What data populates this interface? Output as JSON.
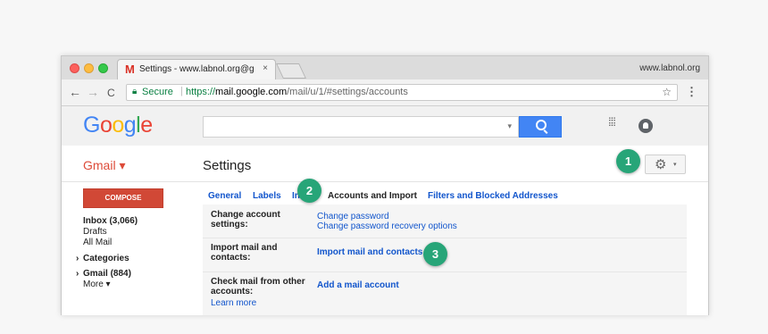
{
  "browser": {
    "tab_title": "Settings - www.labnol.org@gm",
    "tab_favicon": "M",
    "tab_close": "×",
    "window_label": "www.labnol.org",
    "back": "←",
    "forward": "→",
    "reload": "C",
    "secure_label": "Secure",
    "url_protocol": "https://",
    "url_host": "mail.google.com",
    "url_path": "/mail/u/1/#settings/accounts",
    "bookmark_icon": "☆",
    "menu_icon": "⋮"
  },
  "header": {
    "logo": [
      "G",
      "o",
      "o",
      "g",
      "l",
      "e"
    ],
    "search_caret": "▾",
    "apps_icon": "⁞⁞⁞"
  },
  "subbar": {
    "gmail_label": "Gmail ▾",
    "settings_title": "Settings",
    "gear_icon": "⚙",
    "gear_dropdown": "▾"
  },
  "callouts": [
    "1",
    "2",
    "3"
  ],
  "sidebar": {
    "compose_label": "COMPOSE",
    "items": [
      {
        "label": "Inbox (3,066)",
        "bold": true
      },
      {
        "label": "Drafts",
        "bold": false
      },
      {
        "label": "All Mail",
        "bold": false
      },
      {
        "label": "Categories",
        "bold": true,
        "arrow": "›"
      },
      {
        "label": "Gmail (884)",
        "bold": true,
        "arrow": "›"
      },
      {
        "label": "More ▾",
        "bold": false
      }
    ]
  },
  "settings_tabs": [
    "General",
    "Labels",
    "In",
    "Accounts and Import",
    "Filters and Blocked Addresses"
  ],
  "settings_rows": [
    {
      "label": "Change account settings:",
      "links": [
        "Change password",
        "Change password recovery options"
      ]
    },
    {
      "label": "Import mail and contacts:",
      "links": [
        "Import mail and contacts"
      ]
    },
    {
      "label": "Check mail from other accounts:",
      "links": [
        "Add a mail account"
      ],
      "sublink": "Learn more"
    }
  ],
  "colors": {
    "accent_blue": "#4285f4",
    "gmail_red": "#dd4b39",
    "callout_green": "#27a578",
    "link_blue": "#1155cc"
  }
}
